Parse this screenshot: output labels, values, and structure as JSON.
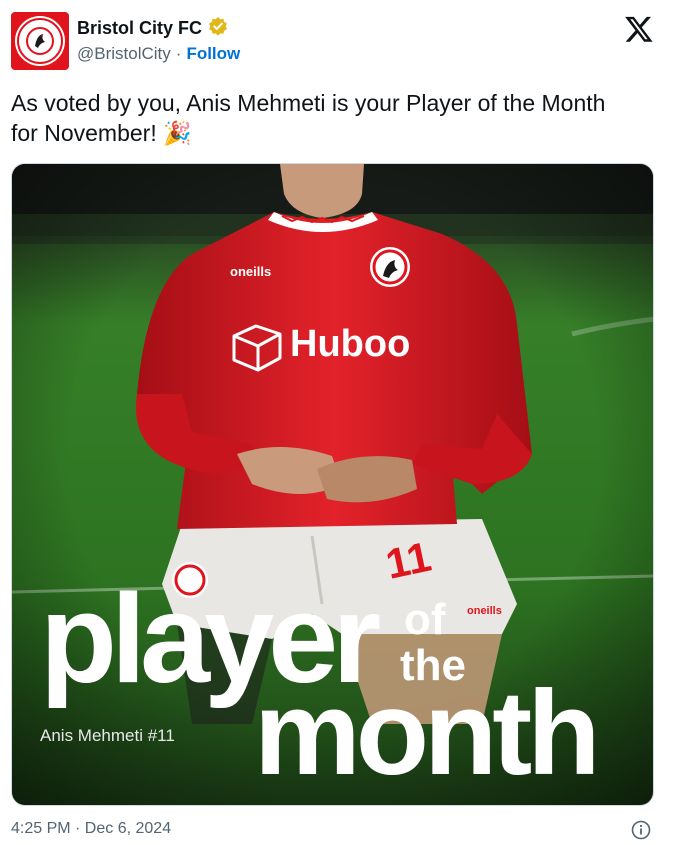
{
  "account": {
    "display_name": "Bristol City FC",
    "handle": "@BristolCity",
    "separator": "·",
    "follow_label": "Follow",
    "verified": true,
    "verified_color": "#f4b400"
  },
  "tweet": {
    "text": "As voted by you, Anis Mehmeti is your Player of the Month for November! 🎉",
    "timestamp": "4:25 PM · Dec 6, 2024"
  },
  "media": {
    "headline_player": "player",
    "headline_of": "of",
    "headline_the": "the",
    "headline_month": "month",
    "caption": "Anis Mehmeti #11",
    "shirt_sponsor": "Huboo",
    "kit_brand": "oneills",
    "shorts_number": "11"
  },
  "colors": {
    "brand_red": "#e0141c",
    "link_blue": "#0074d4",
    "pitch_green": "#2e7a22"
  },
  "icons": {
    "platform": "x-logo-icon",
    "verified": "verified-badge-icon",
    "info": "info-icon"
  }
}
